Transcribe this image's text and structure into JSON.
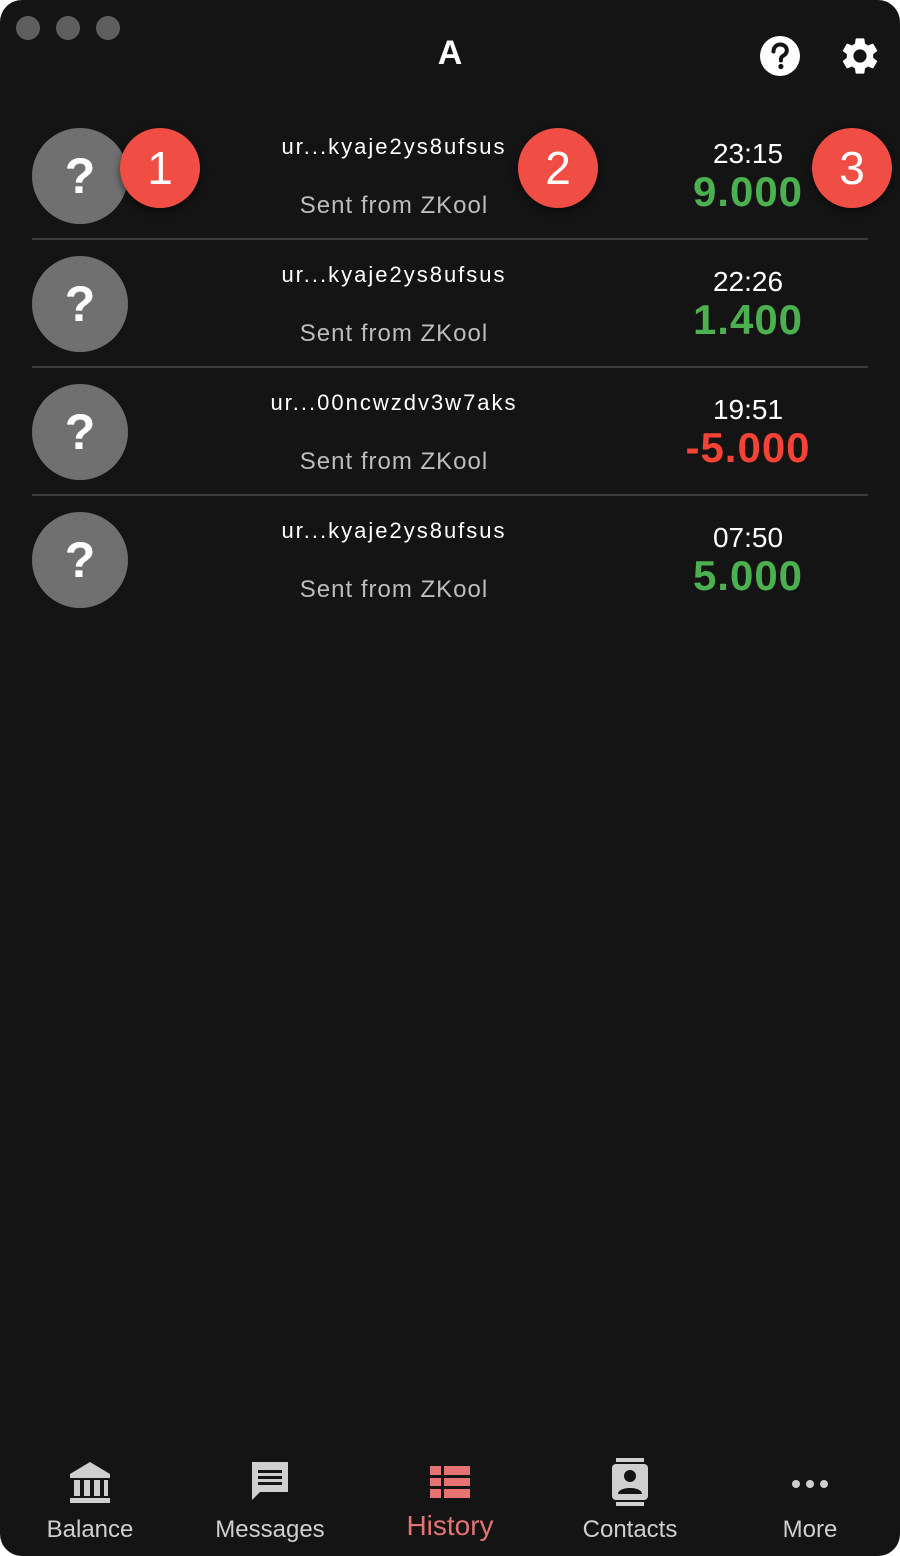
{
  "app": {
    "title": "A"
  },
  "colors": {
    "positive": "#4caf50",
    "negative": "#f44336",
    "accent": "#e57373",
    "badge": "#f04e45"
  },
  "transactions": [
    {
      "avatar": "?",
      "address": "ur...kyaje2ys8ufsus",
      "memo": "Sent from ZKool",
      "time": "23:15",
      "amount": "9.000",
      "direction": "positive"
    },
    {
      "avatar": "?",
      "address": "ur...kyaje2ys8ufsus",
      "memo": "Sent from ZKool",
      "time": "22:26",
      "amount": "1.400",
      "direction": "positive"
    },
    {
      "avatar": "?",
      "address": "ur...00ncwzdv3w7aks",
      "memo": "Sent from ZKool",
      "time": "19:51",
      "amount": "-5.000",
      "direction": "negative"
    },
    {
      "avatar": "?",
      "address": "ur...kyaje2ys8ufsus",
      "memo": "Sent from ZKool",
      "time": "07:50",
      "amount": "5.000",
      "direction": "positive"
    }
  ],
  "badges": [
    "1",
    "2",
    "3"
  ],
  "nav": {
    "items": [
      {
        "label": "Balance",
        "icon": "bank-icon"
      },
      {
        "label": "Messages",
        "icon": "message-icon"
      },
      {
        "label": "History",
        "icon": "history-icon",
        "active": true
      },
      {
        "label": "Contacts",
        "icon": "contacts-icon"
      },
      {
        "label": "More",
        "icon": "more-icon"
      }
    ]
  }
}
